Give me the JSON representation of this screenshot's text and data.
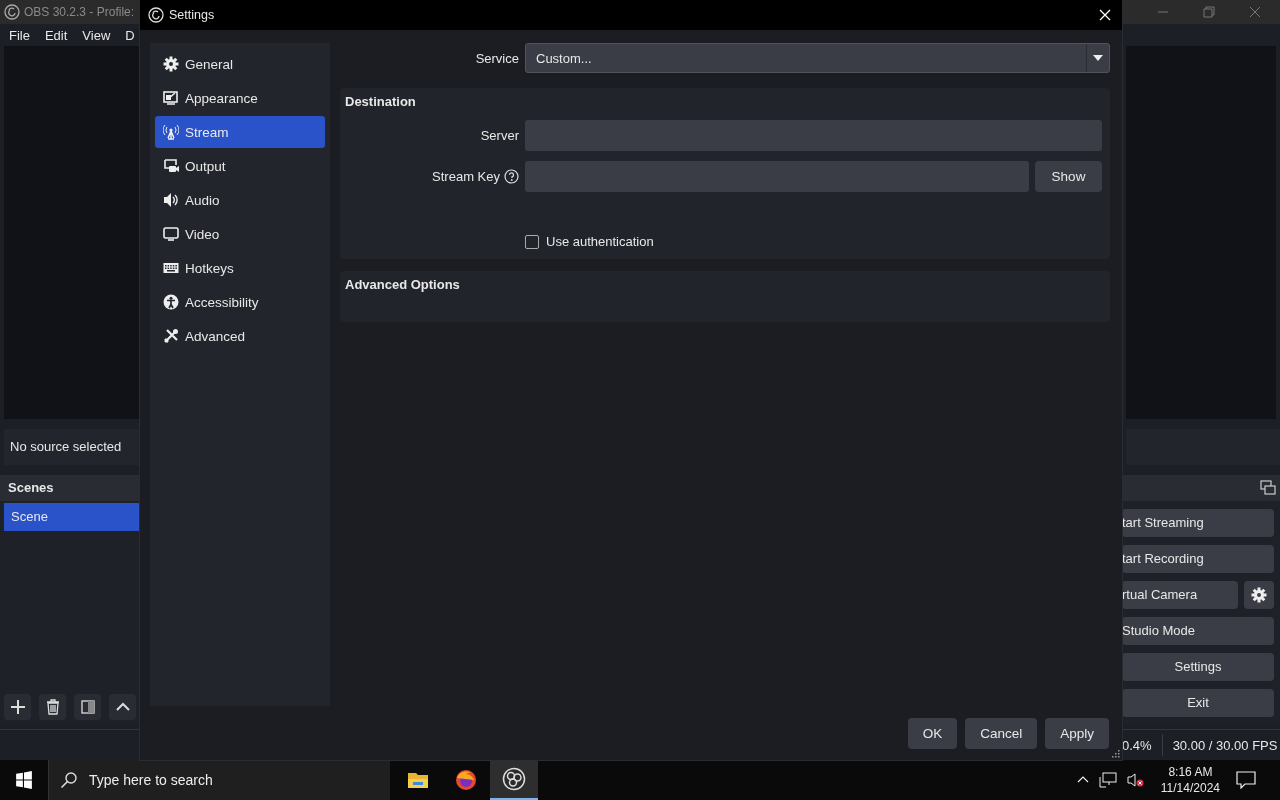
{
  "main_window": {
    "title": "OBS 30.2.3 - Profile:",
    "menu": [
      "File",
      "Edit",
      "View",
      "D"
    ],
    "source_label": "No source selected",
    "scenes": {
      "title": "Scenes",
      "items": [
        {
          "label": "Scene",
          "selected": true
        }
      ]
    },
    "controls": [
      {
        "kind": "button",
        "label": "tart Streaming"
      },
      {
        "kind": "button",
        "label": "tart Recording"
      },
      {
        "kind": "gear_button",
        "label": "rtual Camera"
      },
      {
        "kind": "button",
        "label": "Studio Mode"
      },
      {
        "kind": "button",
        "label": "Settings"
      },
      {
        "kind": "button",
        "label": "Exit"
      }
    ],
    "status": {
      "cpu": "0.4%",
      "fps": "30.00 / 30.00 FPS"
    }
  },
  "dialog": {
    "title": "Settings",
    "sidebar": [
      {
        "label": "General",
        "selected": false
      },
      {
        "label": "Appearance",
        "selected": false
      },
      {
        "label": "Stream",
        "selected": true
      },
      {
        "label": "Output",
        "selected": false
      },
      {
        "label": "Audio",
        "selected": false
      },
      {
        "label": "Video",
        "selected": false
      },
      {
        "label": "Hotkeys",
        "selected": false
      },
      {
        "label": "Accessibility",
        "selected": false
      },
      {
        "label": "Advanced",
        "selected": false
      }
    ],
    "service": {
      "label": "Service",
      "value": "Custom..."
    },
    "destination": {
      "title": "Destination",
      "server_label": "Server",
      "key_label": "Stream Key",
      "show_button": "Show",
      "auth": {
        "label": "Use authentication",
        "checked": false
      }
    },
    "advanced_title": "Advanced Options",
    "buttons": [
      "OK",
      "Cancel",
      "Apply"
    ]
  },
  "taskbar": {
    "search_placeholder": "Type here to search",
    "apps": [
      {
        "selected": false
      },
      {
        "selected": false
      },
      {
        "selected": true
      }
    ],
    "time": "8:16 AM",
    "date": "11/14/2024"
  }
}
